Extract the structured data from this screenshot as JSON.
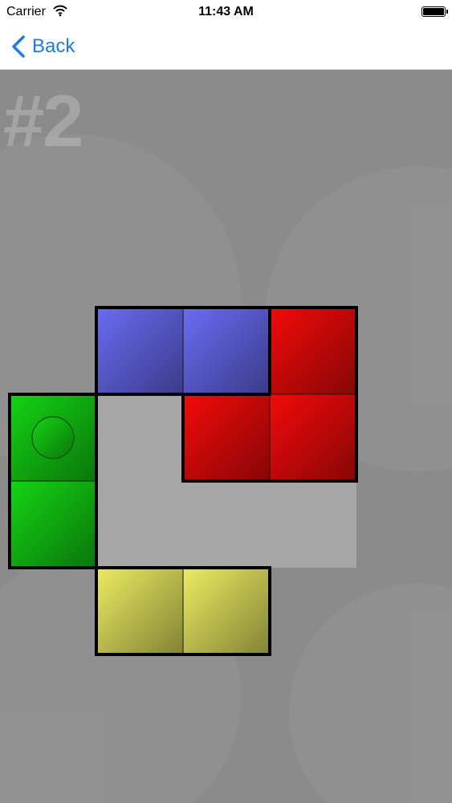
{
  "status_bar": {
    "carrier": "Carrier",
    "time": "11:43 AM",
    "wifi_icon": "wifi-icon",
    "battery_icon": "battery-icon"
  },
  "nav": {
    "back_label": "Back",
    "back_icon": "chevron-left-icon"
  },
  "game": {
    "level_label": "#2",
    "colors": {
      "background": "#8b8b8b",
      "target_area": "#a6a6a6",
      "blue": "#6a6cf5",
      "red": "#f30a0a",
      "green": "#14d414",
      "yellow": "#ecec62",
      "accent": "#1a7cf4"
    },
    "grid": {
      "cols": 4,
      "rows": 4
    },
    "target_cells": [
      [
        1,
        1
      ],
      [
        1,
        2
      ],
      [
        2,
        2
      ],
      [
        3,
        2
      ]
    ],
    "pieces": [
      {
        "name": "blue-piece",
        "color": "blue",
        "cells": [
          [
            1,
            0
          ],
          [
            2,
            0
          ]
        ],
        "marked": false
      },
      {
        "name": "red-piece",
        "color": "red",
        "cells": [
          [
            3,
            0
          ],
          [
            2,
            1
          ],
          [
            3,
            1
          ]
        ],
        "marked": false
      },
      {
        "name": "green-piece",
        "color": "green",
        "cells": [
          [
            0,
            1
          ],
          [
            0,
            2
          ]
        ],
        "marked": true
      },
      {
        "name": "yellow-piece",
        "color": "yellow",
        "cells": [
          [
            1,
            3
          ],
          [
            2,
            3
          ]
        ],
        "marked": false
      }
    ]
  }
}
